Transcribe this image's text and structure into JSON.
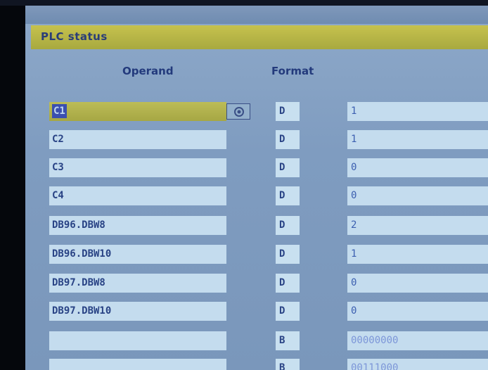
{
  "window": {
    "title": "PLC status"
  },
  "headers": {
    "operand": "Operand",
    "format": "Format"
  },
  "rows": [
    {
      "operand": "C1",
      "format": "D",
      "value": "1"
    },
    {
      "operand": "C2",
      "format": "D",
      "value": "1"
    },
    {
      "operand": "C3",
      "format": "D",
      "value": "0"
    },
    {
      "operand": "C4",
      "format": "D",
      "value": "0"
    },
    {
      "operand": "DB96.DBW8",
      "format": "D",
      "value": "2"
    },
    {
      "operand": "DB96.DBW10",
      "format": "D",
      "value": "1"
    },
    {
      "operand": "DB97.DBW8",
      "format": "D",
      "value": "0"
    },
    {
      "operand": "DB97.DBW10",
      "format": "D",
      "value": "0"
    },
    {
      "operand": "",
      "format": "B",
      "value": "00000000"
    },
    {
      "operand": "",
      "format": "B",
      "value": "00111000"
    }
  ],
  "icons": {
    "lookup": "search-icon"
  },
  "colors": {
    "title_bar": "#b4b448",
    "field_bg": "#c4dcee",
    "screen_bg": "#7f9cc0",
    "text": "#294385"
  }
}
